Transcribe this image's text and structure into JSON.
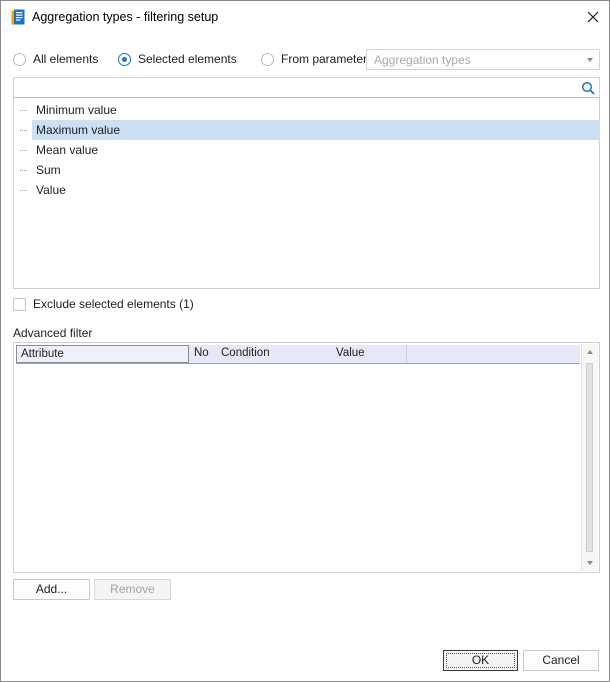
{
  "window": {
    "title": "Aggregation types - filtering setup",
    "close_icon": "close-icon",
    "app_icon": "document-icon"
  },
  "selection_mode": {
    "options": [
      {
        "label": "All elements",
        "checked": false
      },
      {
        "label": "Selected elements",
        "checked": true
      },
      {
        "label": "From parameter:",
        "checked": false
      }
    ],
    "parameter_combo": {
      "value": "Aggregation types",
      "enabled": false
    }
  },
  "search": {
    "value": "",
    "icon": "search-icon"
  },
  "tree": {
    "items": [
      {
        "label": "Minimum value",
        "selected": false
      },
      {
        "label": "Maximum value",
        "selected": true
      },
      {
        "label": "Mean value",
        "selected": false
      },
      {
        "label": "Sum",
        "selected": false
      },
      {
        "label": "Value",
        "selected": false
      }
    ]
  },
  "exclude": {
    "label": "Exclude selected elements (1)",
    "checked": false
  },
  "advanced_filter": {
    "label": "Advanced filter",
    "columns": [
      "Attribute",
      "No",
      "Condition",
      "Value"
    ],
    "rows": []
  },
  "buttons": {
    "add": "Add...",
    "remove": "Remove",
    "ok": "OK",
    "cancel": "Cancel"
  },
  "colors": {
    "accent": "#1d73c9",
    "selection": "#cce0f4",
    "grid_header": "#e6e8f7"
  }
}
